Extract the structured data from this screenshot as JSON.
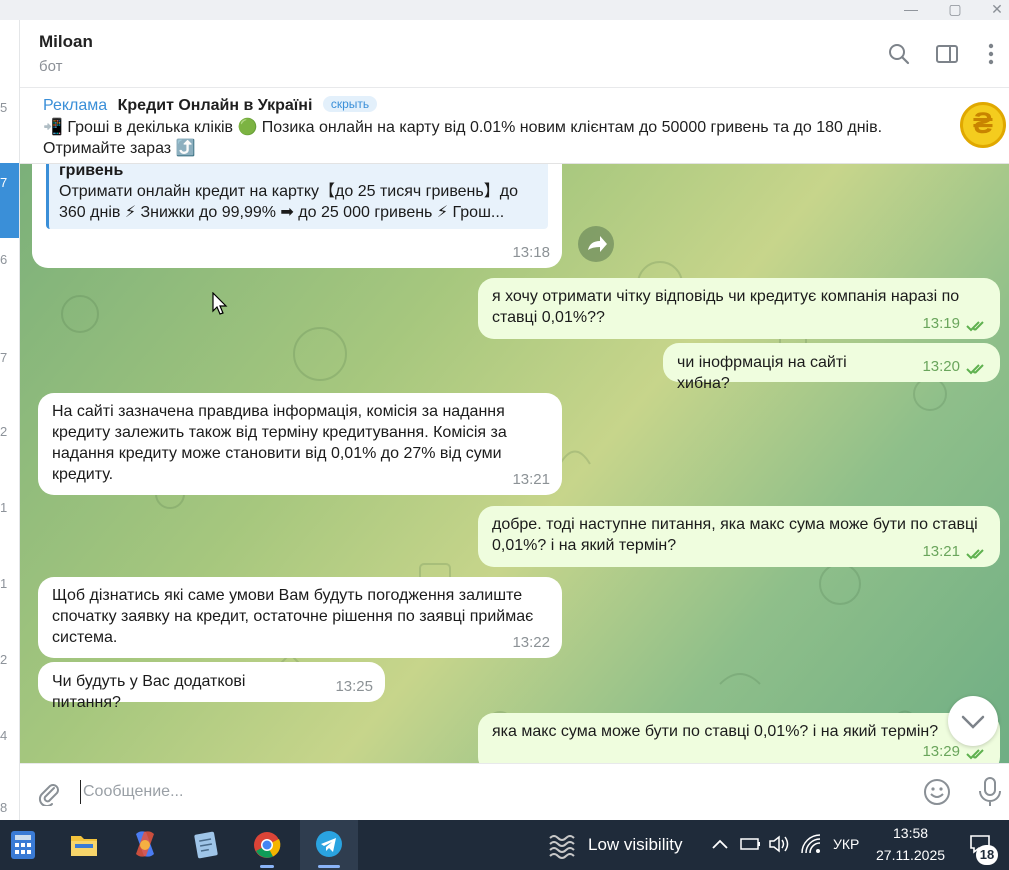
{
  "window": {
    "minimize": "—",
    "maximize": "▢",
    "close": "✕"
  },
  "sidebar": {
    "numbers": [
      "5",
      "7",
      "6",
      "7",
      "2",
      "1",
      "1",
      "2",
      "4",
      "8"
    ]
  },
  "header": {
    "title": "Miloan",
    "subtitle": "бот"
  },
  "ad": {
    "tag": "Реклама",
    "title": "Кредит Онлайн в Україні",
    "hide_label": "скрыть",
    "text": "📲 Гроші в декілька кліків 🟢 Позика онлайн на карту від 0.01% новим клієнтам до 50000 гривень та до 180 днів. Отримайте зараз ⤴️",
    "coin_symbol": "₴"
  },
  "messages": [
    {
      "side": "in",
      "quote_head": "гривень",
      "quote_text": "Отримати онлайн кредит на картку【до 25 тисяч гривень】до 360 днів ⚡ Знижки до 99,99% ➡ до 25 000 гривень ⚡ Грош...",
      "time": "13:18"
    },
    {
      "side": "out",
      "text": "я хочу отримати чітку відповідь чи кредитує компанія наразі по ставці 0,01%??",
      "time": "13:19"
    },
    {
      "side": "out",
      "text": "чи інофрмація на сайті хибна?",
      "time": "13:20"
    },
    {
      "side": "in",
      "text": "На сайті зазначена правдива інформація, комісія за надання кредиту залежить також від терміну кредитування. Комісія за надання кредиту може становити від 0,01% до 27% від суми кредиту.",
      "time": "13:21"
    },
    {
      "side": "out",
      "text": "добре. тоді наступне питання, яка макс сума може бути по ставці 0,01%? і на який термін?",
      "time": "13:21"
    },
    {
      "side": "in",
      "text": "Щоб дізнатись які саме умови Вам будуть погодження залиште спочатку заявку на кредит, остаточне рішення по заявці приймає система.",
      "time": "13:22"
    },
    {
      "side": "in",
      "text": "Чи будуть у Вас додаткові питання?",
      "time": "13:25"
    },
    {
      "side": "out",
      "text": "яка макс сума може бути по ставці 0,01%? і на який термін?",
      "time": "13:29"
    }
  ],
  "input": {
    "placeholder": "Сообщение..."
  },
  "taskbar": {
    "weather": "Low visibility",
    "language": "УКР",
    "time": "13:58",
    "date": "27.11.2025",
    "notifications": "18"
  }
}
